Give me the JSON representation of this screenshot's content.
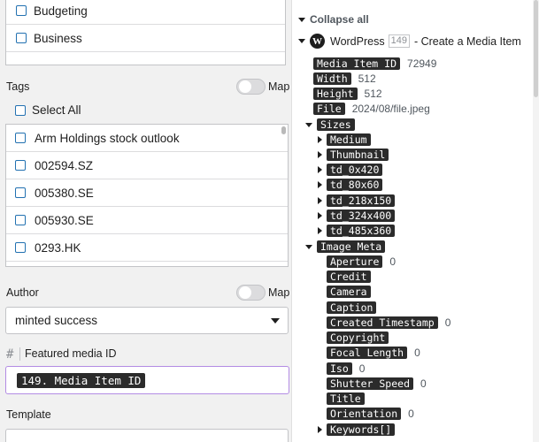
{
  "categories": [
    "Budgeting",
    "Business"
  ],
  "tags": {
    "section_label": "Tags",
    "map_label": "Map",
    "select_all_label": "Select All",
    "items": [
      "Arm Holdings stock outlook",
      "002594.SZ",
      "005380.SE",
      "005930.SE",
      "0293.HK"
    ]
  },
  "author": {
    "section_label": "Author",
    "map_label": "Map",
    "selected": "minted success"
  },
  "featured_media": {
    "hash_icon": "#",
    "label": "Featured media ID",
    "value_pill": "149. Media Item ID"
  },
  "template": {
    "label": "Template"
  },
  "tree": {
    "collapse_all": "Collapse all",
    "root": {
      "logo_glyph": "W",
      "title": "WordPress",
      "count": "149",
      "rest": "- Create a Media Item"
    },
    "media_item_id": {
      "label": "Media Item ID",
      "value": "72949"
    },
    "width": {
      "label": "Width",
      "value": "512"
    },
    "height": {
      "label": "Height",
      "value": "512"
    },
    "file": {
      "label": "File",
      "value": "2024/08/file.jpeg"
    },
    "sizes": {
      "label": "Sizes",
      "children": [
        "Medium",
        "Thumbnail",
        "td_0x420",
        "td_80x60",
        "td_218x150",
        "td_324x400",
        "td_485x360"
      ]
    },
    "image_meta": {
      "label": "Image Meta",
      "aperture": {
        "label": "Aperture",
        "value": "0"
      },
      "credit": {
        "label": "Credit"
      },
      "camera": {
        "label": "Camera"
      },
      "caption": {
        "label": "Caption"
      },
      "created_timestamp": {
        "label": "Created Timestamp",
        "value": "0"
      },
      "copyright": {
        "label": "Copyright"
      },
      "focal_length": {
        "label": "Focal Length",
        "value": "0"
      },
      "iso": {
        "label": "Iso",
        "value": "0"
      },
      "shutter_speed": {
        "label": "Shutter Speed",
        "value": "0"
      },
      "title": {
        "label": "Title"
      },
      "orientation": {
        "label": "Orientation",
        "value": "0"
      },
      "keywords": {
        "label": "Keywords[]"
      }
    }
  }
}
